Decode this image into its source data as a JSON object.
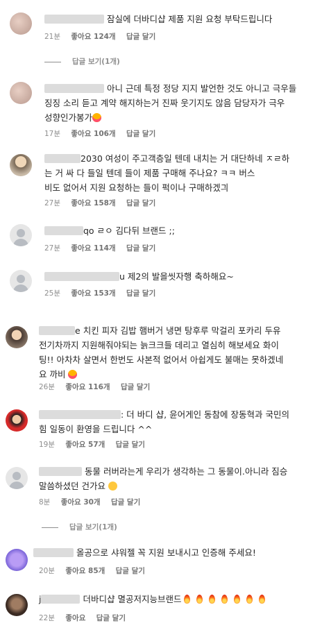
{
  "comments": [
    {
      "user": "u.s.rs.ls.t.s",
      "text_lines": [
        "잠실에 더바디샵 제품 지원 요청 부탁드립니다"
      ],
      "time": "21분",
      "likes": "좋아요 124개",
      "reply": "답글 달기",
      "view_replies": "답글 보기(1개)"
    },
    {
      "user": "u.s.rs.ls.t.s",
      "text_lines": [
        "아니 근데 특정 정당 지지 발언한 것도 아니고 극우들",
        "징징 소리 듣고 계약 해지하는거 진짜 웃기지도 않음 담당자가 극우",
        "성향인가봉가"
      ],
      "time": "17분",
      "likes": "좋아요 106개",
      "reply": "답글 달기"
    },
    {
      "user": "",
      "text_lines": [
        "2030 여성이 주고객층일 텐데 내치는 거 대단하네 ㅈㄹ하",
        "는 거 싸 다 들일 텐데 들이 제품 구매해 주나요? ㅋㅋ 버스",
        "비도 없어서 지원 요청하는 들이 퍽이나 구매하겠긔"
      ],
      "time": "27분",
      "likes": "좋아요 158개",
      "reply": "답글 달기"
    },
    {
      "user": "qo",
      "text_lines": [
        "ㄹㅇ 김다뒤 브랜드 ;;"
      ],
      "time": "27분",
      "likes": "좋아요 114개",
      "reply": "답글 달기"
    },
    {
      "user": "u",
      "text_lines": [
        "제2의 발을씻자행 축하해요~"
      ],
      "time": "25분",
      "likes": "좋아요 153개",
      "reply": "답글 달기"
    },
    {
      "user": "e",
      "text_lines": [
        "치킨 피자 김밥 햄버거 냉면 탕후루 막걸리 포카리 두유",
        "전기차까지 지원해줘야되는 늙크크들 데리고 열심히 해보세요 화이",
        "팅!! 아차차 살면서 한번도 사본적 없어서 아쉽게도 불매는 못하겠네",
        "요 까비"
      ],
      "time": "26분",
      "likes": "좋아요 116개",
      "reply": "답글 달기"
    },
    {
      "user": "",
      "text_lines": [
        ": 더 바디 샵, 윤어게인 동참에 장동혁과 국민의",
        "힘 일동이 환영을 드립니다 ^^"
      ],
      "time": "19분",
      "likes": "좋아요 57개",
      "reply": "답글 달기"
    },
    {
      "user": "",
      "text_lines": [
        "동물 러버라는게 우리가 생각하는 그 동물이.아니라 짐승",
        "말씀하셨던 건가요"
      ],
      "time": "8분",
      "likes": "좋아요 30개",
      "reply": "답글 달기",
      "view_replies": "답글 보기(1개)"
    },
    {
      "user": "",
      "text_lines": [
        "올공으로 샤워젤 꼭 지원 보내시고 인증해 주세요!"
      ],
      "time": "20분",
      "likes": "좋아요 85개",
      "reply": "답글 달기"
    },
    {
      "user": "j",
      "text_lines": [
        "더바디샵 멸공저지능브랜드"
      ],
      "time": "22분",
      "likes": "좋아요",
      "reply": "답글 달기"
    }
  ],
  "colors": {
    "text": "#262626",
    "meta": "#8e8e8e",
    "blur": "#dcdcdc",
    "avatar_default": "#e6e6e6"
  },
  "icons": [
    "user-avatar",
    "default-avatar-icon",
    "tongue-emoji-icon",
    "thinking-emoji-icon",
    "fire-emoji-icon"
  ]
}
